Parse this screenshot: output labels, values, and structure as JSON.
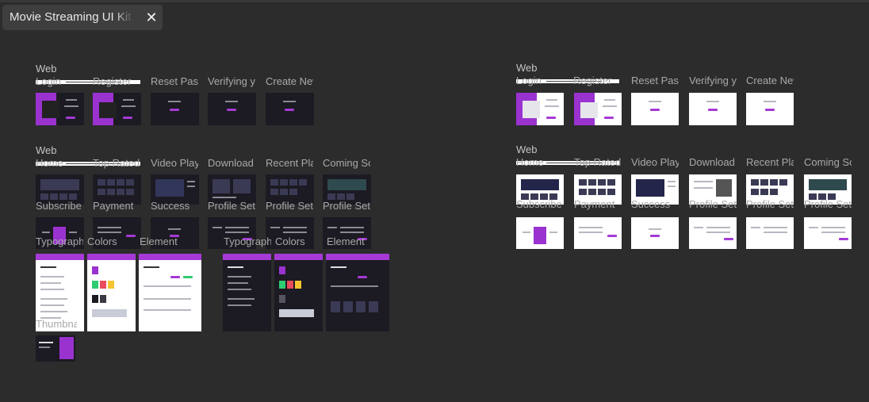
{
  "tab": {
    "title": "Movie Streaming UI Kit",
    "close_icon": "close-icon"
  },
  "groups": {
    "dark_auth": {
      "section": "Web",
      "labels": [
        "Login",
        "Register",
        "Reset Password",
        "Verifying your email",
        "Create New Password"
      ]
    },
    "dark_main": {
      "section": "Web",
      "labels": [
        "Home",
        "Top Rated",
        "Video Player",
        "Download",
        "Recent Played",
        "Coming Soon"
      ]
    },
    "dark_account": {
      "labels": [
        "Subscribe",
        "Payment",
        "Success",
        "Profile Setting",
        "Profile Setting",
        "Profile Setting"
      ]
    },
    "styles_light": {
      "labels": [
        "Typography",
        "Colors",
        "Element"
      ]
    },
    "styles_dark": {
      "labels": [
        "Typography",
        "Colors",
        "Element"
      ]
    },
    "thumbnail": {
      "labels": [
        "Thumbnail"
      ]
    },
    "light_auth": {
      "section": "Web",
      "labels": [
        "Login",
        "Register",
        "Reset Password",
        "Verifying your email",
        "Create New Password"
      ]
    },
    "light_main": {
      "section": "Web",
      "labels": [
        "Home",
        "Top Rated",
        "Video Player",
        "Download",
        "Recent Played",
        "Coming Soon"
      ]
    },
    "light_account": {
      "labels": [
        "Subscribe",
        "Payment",
        "Success",
        "Profile Setting",
        "Profile Setting",
        "Profile Setting"
      ]
    }
  },
  "colors": {
    "canvas": "#2c2c2c",
    "accent": "#a53ad6",
    "dark_frame": "#1c1a22",
    "light_frame": "#ffffff"
  }
}
